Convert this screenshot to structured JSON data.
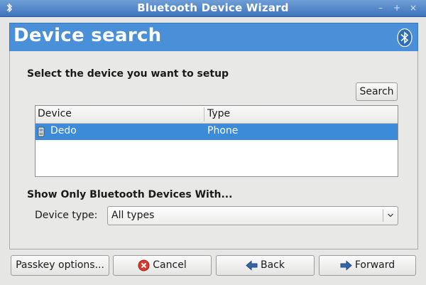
{
  "window": {
    "title": "Bluetooth Device Wizard",
    "controls": {
      "minimize": "–",
      "maximize": "+",
      "close": "×"
    }
  },
  "header": {
    "heading": "Device search",
    "logo_icon": "bluetooth-icon"
  },
  "select_section": {
    "label": "Select the device you want to setup",
    "search_button": "Search"
  },
  "device_list": {
    "columns": [
      "Device",
      "Type"
    ],
    "rows": [
      {
        "icon": "phone-icon",
        "device": "Dedo",
        "type": "Phone",
        "selected": true
      }
    ]
  },
  "filter_section": {
    "label": "Show Only Bluetooth Devices With...",
    "device_type_label": "Device type:",
    "device_type_value": "All types"
  },
  "buttons": {
    "passkey": "Passkey options...",
    "cancel": "Cancel",
    "back": "Back",
    "forward": "Forward"
  },
  "colors": {
    "accent": "#4a90d9",
    "selection": "#3b8bd8",
    "cancel_icon": "#d93a2b",
    "arrow_icon": "#3465a4"
  }
}
